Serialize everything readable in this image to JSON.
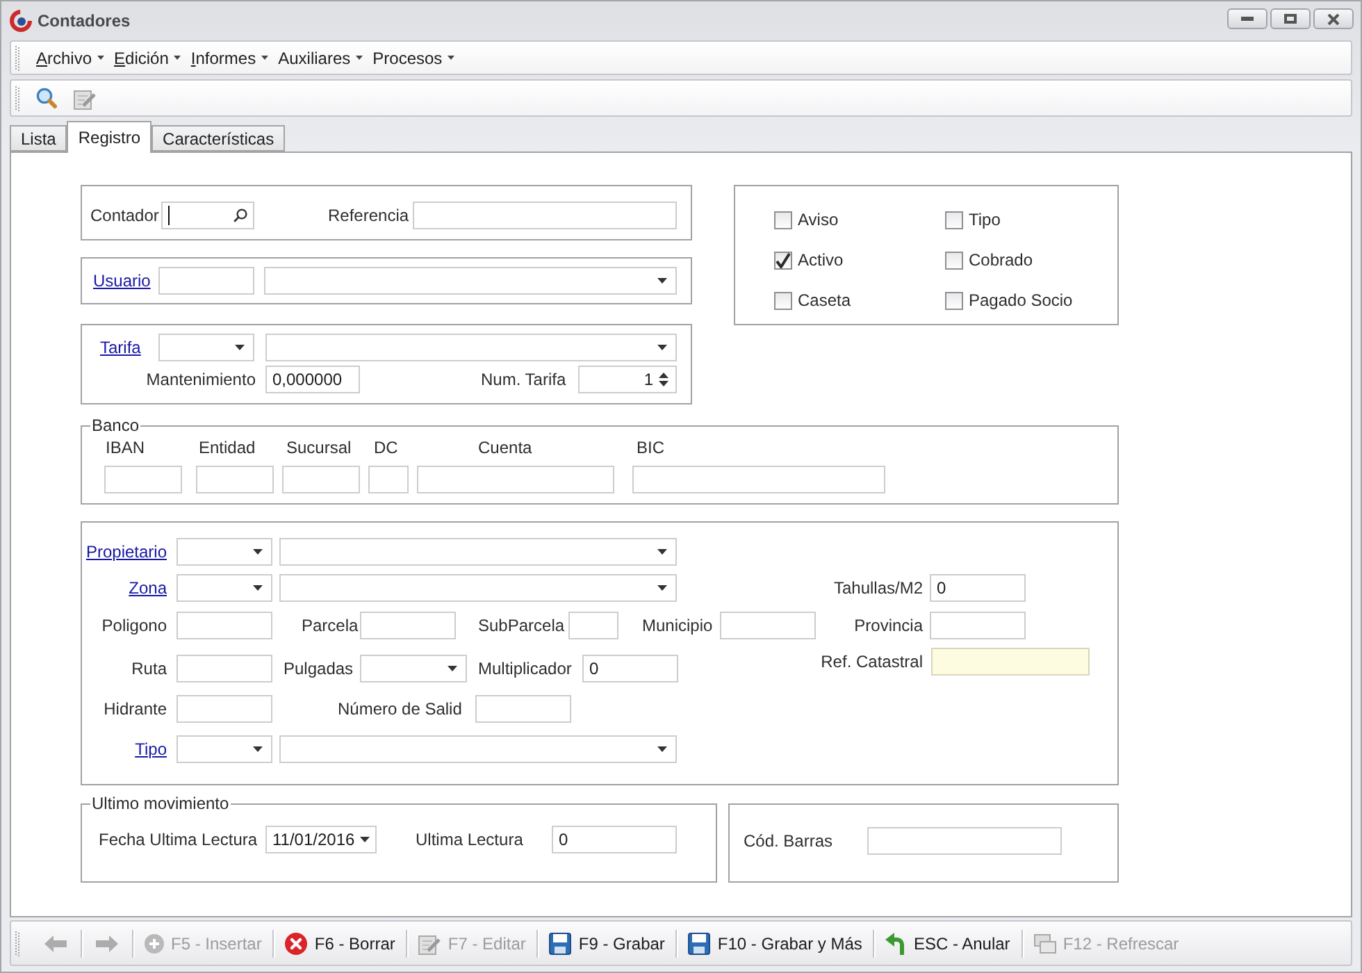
{
  "window": {
    "title": "Contadores"
  },
  "menu": [
    {
      "label": "Archivo",
      "mnemonic": true
    },
    {
      "label": "Edición",
      "mnemonic": true
    },
    {
      "label": "Informes",
      "mnemonic": true
    },
    {
      "label": "Auxiliares",
      "mnemonic": false
    },
    {
      "label": "Procesos",
      "mnemonic": false
    }
  ],
  "toolbar": [
    {
      "kind": "search",
      "disabled": false
    },
    {
      "kind": "edit",
      "disabled": true
    }
  ],
  "tabs": [
    {
      "label": "Lista",
      "selected": false
    },
    {
      "label": "Registro",
      "selected": true
    },
    {
      "label": "Características",
      "selected": false
    }
  ],
  "identificacion": {
    "contador": {
      "label": "Contador",
      "focused": true
    },
    "referencia": {
      "label": "Referencia"
    }
  },
  "usuario": {
    "label": "Usuario"
  },
  "tarifa": {
    "label": "Tarifa",
    "mantenimiento": {
      "label": "Mantenimiento",
      "value": "0,000000"
    },
    "num_tarifa": {
      "label": "Num. Tarifa",
      "value": "1"
    }
  },
  "flags": [
    {
      "label": "Aviso",
      "checked": false
    },
    {
      "label": "Tipo",
      "checked": false
    },
    {
      "label": "Activo",
      "checked": true
    },
    {
      "label": "Cobrado",
      "checked": false
    },
    {
      "label": "Caseta",
      "checked": false
    },
    {
      "label": "Pagado Socio",
      "checked": false
    }
  ],
  "banco": {
    "legend": "Banco",
    "fields": [
      {
        "label": "IBAN"
      },
      {
        "label": "Entidad"
      },
      {
        "label": "Sucursal"
      },
      {
        "label": "DC"
      },
      {
        "label": "Cuenta"
      },
      {
        "label": "BIC"
      }
    ]
  },
  "parcela": {
    "propietario": {
      "label": "Propietario"
    },
    "zona": {
      "label": "Zona"
    },
    "tahullas": {
      "label": "Tahullas/M2",
      "value": "0"
    },
    "poligono": {
      "label": "Poligono"
    },
    "parcela": {
      "label": "Parcela"
    },
    "subparcela": {
      "label": "SubParcela"
    },
    "municipio": {
      "label": "Municipio"
    },
    "provincia": {
      "label": "Provincia"
    },
    "ruta": {
      "label": "Ruta"
    },
    "pulgadas": {
      "label": "Pulgadas"
    },
    "multiplicador": {
      "label": "Multiplicador",
      "value": "0"
    },
    "ref_catastral": {
      "label": "Ref. Catastral",
      "highlighted": true
    },
    "hidrante": {
      "label": "Hidrante"
    },
    "numero_salida": {
      "label": "Número de Salid"
    },
    "tipo": {
      "label": "Tipo"
    }
  },
  "ultimo_movimiento": {
    "legend": "Ultimo movimiento",
    "fecha": {
      "label": "Fecha Ultima Lectura",
      "value": "11/01/2016"
    },
    "lectura": {
      "label": "Ultima Lectura",
      "value": "0"
    }
  },
  "codigo_barras": {
    "label": "Cód. Barras"
  },
  "actions": [
    {
      "kind": "back",
      "disabled": true
    },
    {
      "kind": "forward",
      "disabled": true
    },
    {
      "kind": "insert",
      "label": "F5 - Insertar",
      "disabled": true
    },
    {
      "kind": "delete",
      "label": "F6 - Borrar",
      "disabled": false
    },
    {
      "kind": "edit",
      "label": "F7 - Editar",
      "disabled": true
    },
    {
      "kind": "save",
      "label": "F9 - Grabar",
      "disabled": false
    },
    {
      "kind": "save_more",
      "label": "F10 - Grabar y Más",
      "disabled": false
    },
    {
      "kind": "undo",
      "label": "ESC - Anular",
      "disabled": false
    },
    {
      "kind": "refresh",
      "label": "F12 - Refrescar",
      "disabled": true
    }
  ]
}
